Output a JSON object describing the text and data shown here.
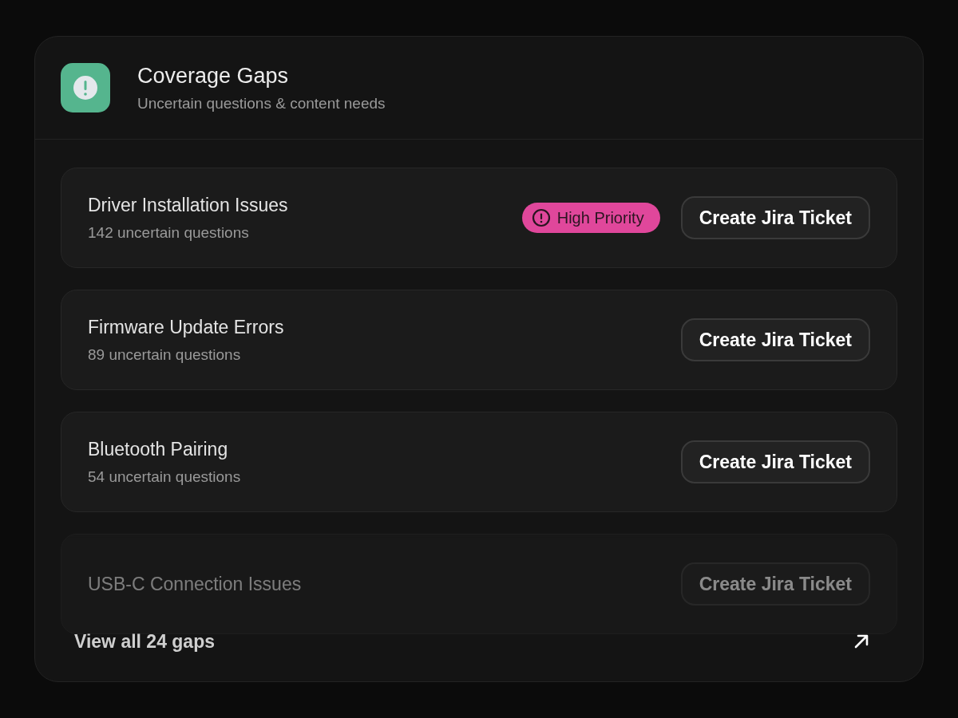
{
  "header": {
    "title": "Coverage Gaps",
    "subtitle": "Uncertain questions & content needs"
  },
  "gaps": [
    {
      "title": "Driver Installation Issues",
      "count": "142 uncertain questions",
      "badge": "High Priority",
      "button": "Create Jira Ticket"
    },
    {
      "title": "Firmware Update Errors",
      "count": "89 uncertain questions",
      "button": "Create Jira Ticket"
    },
    {
      "title": "Bluetooth Pairing",
      "count": "54 uncertain questions",
      "button": "Create Jira Ticket"
    },
    {
      "title": "USB-C Connection Issues",
      "button": "Create Jira Ticket"
    }
  ],
  "footer": {
    "link": "View all 24 gaps"
  }
}
